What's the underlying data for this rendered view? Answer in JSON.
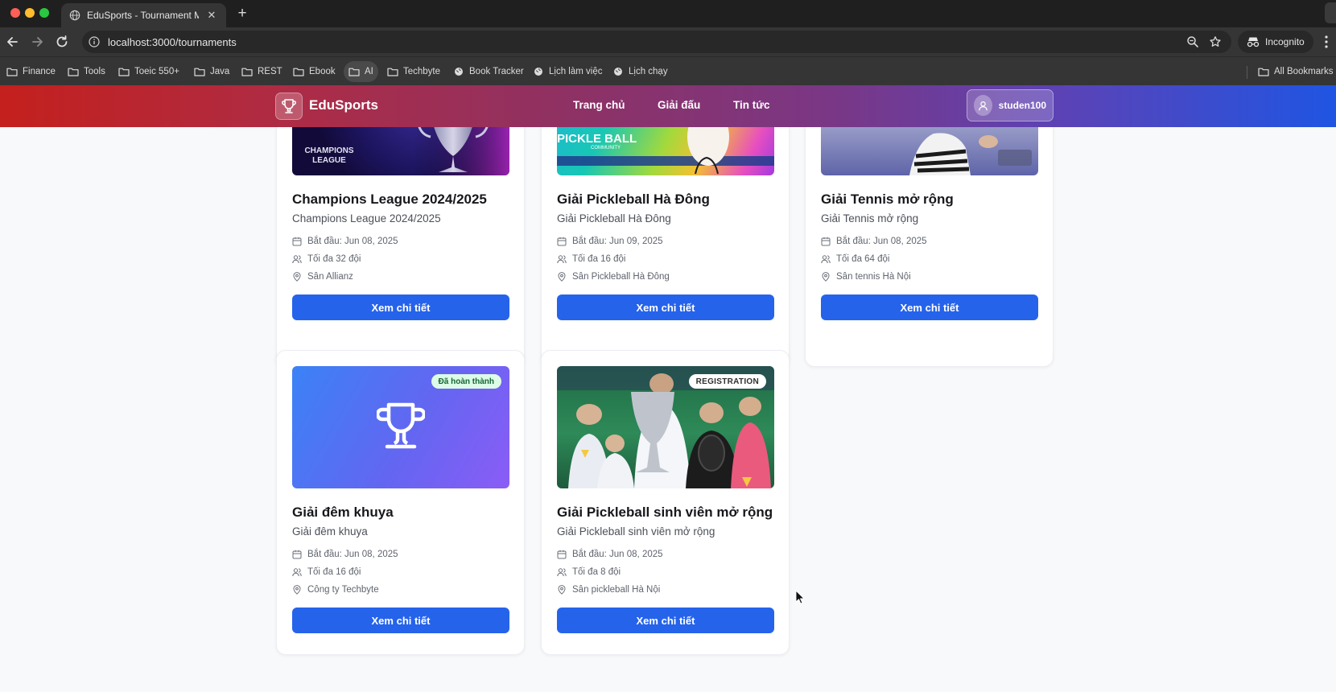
{
  "browser": {
    "tab_title": "EduSports - Tournament Man",
    "url": "localhost:3000/tournaments",
    "profile_label": "Incognito",
    "bookmarks": [
      {
        "label": "Finance",
        "icon": "folder-icon"
      },
      {
        "label": "Tools",
        "icon": "folder-icon"
      },
      {
        "label": "Toeic 550+",
        "icon": "folder-icon"
      },
      {
        "label": "Java",
        "icon": "folder-icon"
      },
      {
        "label": "REST",
        "icon": "folder-icon"
      },
      {
        "label": "Ebook",
        "icon": "folder-icon"
      },
      {
        "label": "AI",
        "icon": "folder-icon"
      },
      {
        "label": "Techbyte",
        "icon": "folder-icon"
      },
      {
        "label": "Book Tracker",
        "icon": "globe-icon"
      },
      {
        "label": "Lịch làm việc",
        "icon": "globe-icon"
      },
      {
        "label": "Lịch chạy",
        "icon": "globe-icon"
      }
    ],
    "all_bookmarks_label": "All Bookmarks"
  },
  "header": {
    "brand": "EduSports",
    "nav": [
      "Trang chủ",
      "Giải đấu",
      "Tin tức"
    ],
    "username": "studen100"
  },
  "colors": {
    "primary_button": "#2563eb",
    "badge_done_bg": "#dcfce7",
    "badge_done_text": "#166534"
  },
  "tournaments": [
    {
      "title": "Champions League 2024/2025",
      "subtitle": "Champions League 2024/2025",
      "start": "Bắt đầu: Jun 08, 2025",
      "teams": "Tối đa 32 đội",
      "venue": "Sân Allianz",
      "media_caption": "CHAMPIONS LEAGUE",
      "button": "Xem chi tiết"
    },
    {
      "title": "Giải Pickleball Hà Đông",
      "subtitle": "Giải Pickleball Hà Đông",
      "start": "Bắt đầu: Jun 09, 2025",
      "teams": "Tối đa 16 đội",
      "venue": "Sân Pickleball Hà Đông",
      "media_caption": "PICKLE BALL",
      "media_caption_small": "COMMUNITY",
      "button": "Xem chi tiết"
    },
    {
      "title": "Giải Tennis mở rộng",
      "subtitle": "Giải Tennis mở rộng",
      "start": "Bắt đầu: Jun 08, 2025",
      "teams": "Tối đa 64 đội",
      "venue": "Sân tennis Hà Nội",
      "button": "Xem chi tiết"
    },
    {
      "title": "Giải đêm khuya",
      "subtitle": "Giải đêm khuya",
      "start": "Bắt đầu: Jun 08, 2025",
      "teams": "Tối đa 16 đội",
      "venue": "Công ty Techbyte",
      "badge": "Đã hoàn thành",
      "button": "Xem chi tiết"
    },
    {
      "title": "Giải Pickleball sinh viên mở rộng",
      "subtitle": "Giải Pickleball sinh viên mở rộng",
      "start": "Bắt đầu: Jun 08, 2025",
      "teams": "Tối đa 8 đội",
      "venue": "Sân pickleball Hà Nội",
      "badge": "REGISTRATION",
      "button": "Xem chi tiết"
    }
  ]
}
